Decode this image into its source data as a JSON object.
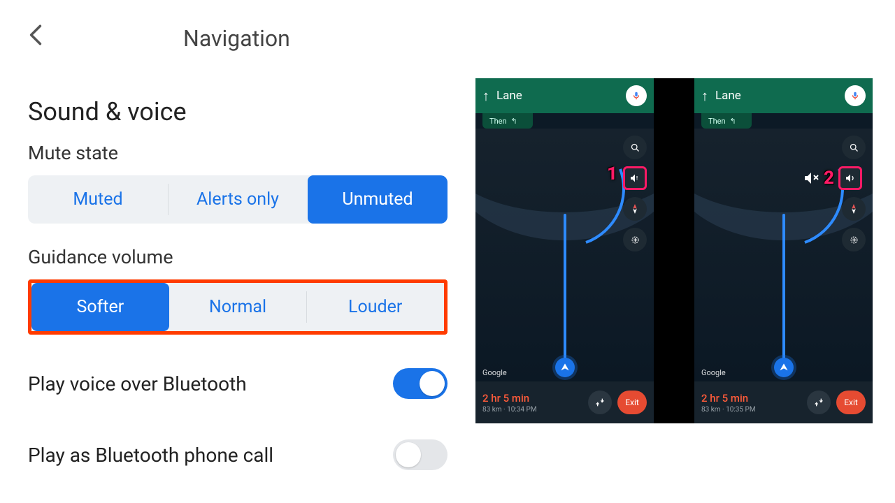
{
  "header": {
    "title": "Navigation"
  },
  "section": {
    "title": "Sound & voice"
  },
  "mute": {
    "title": "Mute state",
    "items": [
      "Muted",
      "Alerts only",
      "Unmuted"
    ],
    "active": 2
  },
  "volume": {
    "title": "Guidance volume",
    "items": [
      "Softer",
      "Normal",
      "Louder"
    ],
    "active": 0,
    "highlighted": true
  },
  "toggles": {
    "bluetooth": {
      "label": "Play voice over Bluetooth",
      "on": true
    },
    "phonecall": {
      "label": "Play as Bluetooth phone call",
      "on": false
    }
  },
  "phones": [
    {
      "lane": "Lane",
      "then": "Then",
      "annot": "1",
      "eta_main": "2 hr 5 min",
      "eta_sub": "83 km · 10:34 PM",
      "exit": "Exit",
      "brand": "Google"
    },
    {
      "lane": "Lane",
      "then": "Then",
      "annot": "2",
      "eta_main": "2 hr 5 min",
      "eta_sub": "83 km · 10:35 PM",
      "exit": "Exit",
      "brand": "Google"
    }
  ]
}
